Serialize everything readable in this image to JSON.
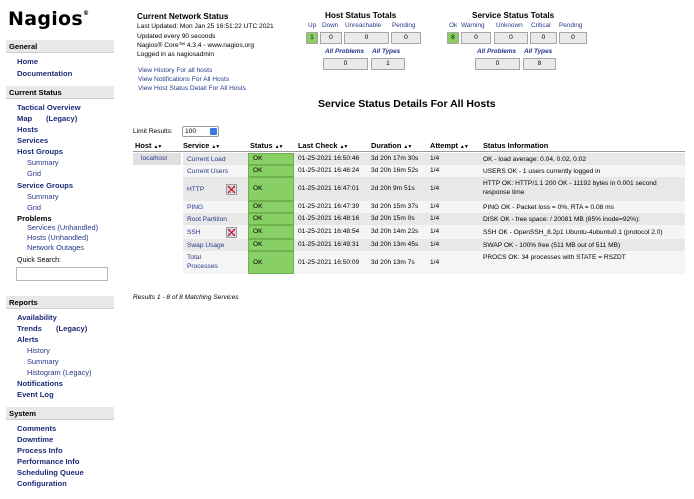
{
  "brand": {
    "name": "Nagios",
    "mark": "®"
  },
  "sidebar": {
    "general": {
      "title": "General",
      "items": [
        "Home",
        "Documentation"
      ]
    },
    "current_status": {
      "title": "Current Status",
      "tactical": "Tactical Overview",
      "map": "Map",
      "map_legacy": "(Legacy)",
      "hosts": "Hosts",
      "services": "Services",
      "host_groups": "Host Groups",
      "host_groups_sub": [
        "Summary",
        "Grid"
      ],
      "service_groups": "Service Groups",
      "service_groups_sub": [
        "Summary",
        "Grid"
      ],
      "problems": "Problems",
      "problems_sub": [
        "Services (Unhandled)",
        "Hosts (Unhandled)",
        "Network Outages"
      ],
      "quick_search": "Quick Search:"
    },
    "reports": {
      "title": "Reports",
      "availability": "Availability",
      "trends": "Trends",
      "trends_legacy": "(Legacy)",
      "alerts": "Alerts",
      "alerts_sub": [
        "History",
        "Summary",
        "Histogram (Legacy)"
      ],
      "notifications": "Notifications",
      "event_log": "Event Log"
    },
    "system": {
      "title": "System",
      "items": [
        "Comments",
        "Downtime",
        "Process Info",
        "Performance Info",
        "Scheduling Queue",
        "Configuration"
      ]
    }
  },
  "network_status": {
    "title": "Current Network Status",
    "last_updated": "Last Updated: Mon Jan 25 16:51:22 UTC 2021",
    "update_freq": "Updated every 90 seconds",
    "version": "Nagios® Core™ 4.3.4 - www.nagios.org",
    "logged_in": "Logged in as nagiosadmin",
    "links": [
      "View History For all hosts",
      "View Notifications For All Hosts",
      "View Host Status Detail For All Hosts"
    ]
  },
  "host_totals": {
    "title": "Host Status Totals",
    "labels": [
      "Up",
      "Down",
      "Unreachable",
      "Pending"
    ],
    "values": [
      "1",
      "0",
      "0",
      "0"
    ],
    "sub_labels": [
      "All Problems",
      "All Types"
    ],
    "sub_values": [
      "0",
      "1"
    ]
  },
  "service_totals": {
    "title": "Service Status Totals",
    "labels": [
      "Ok",
      "Warning",
      "Unknown",
      "Critical",
      "Pending"
    ],
    "values": [
      "8",
      "0",
      "0",
      "0",
      "0"
    ],
    "sub_labels": [
      "All Problems",
      "All Types"
    ],
    "sub_values": [
      "0",
      "8"
    ]
  },
  "main": {
    "title": "Service Status Details For All Hosts",
    "limit_label": "Limit Results:",
    "limit_value": "100",
    "columns": [
      "Host",
      "Service",
      "Status",
      "Last Check",
      "Duration",
      "Attempt",
      "Status Information"
    ],
    "host": "localhost",
    "rows": [
      {
        "service": "Current Load",
        "status": "OK",
        "last_check": "01-25-2021 16:50:46",
        "duration": "3d 20h 17m 30s",
        "attempt": "1/4",
        "info": "OK - load average: 0.04, 0.02, 0.02"
      },
      {
        "service": "Current Users",
        "status": "OK",
        "last_check": "01-25-2021 16:46:24",
        "duration": "3d 20h 16m 52s",
        "attempt": "1/4",
        "info": "USERS OK - 1 users currently logged in"
      },
      {
        "service": "HTTP",
        "status": "OK",
        "last_check": "01-25-2021 16:47:01",
        "duration": "2d 20h 9m 51s",
        "attempt": "1/4",
        "info": "HTTP OK: HTTP/1.1 200 OK - 11192 bytes in 0.001 second response time"
      },
      {
        "service": "PING",
        "status": "OK",
        "last_check": "01-25-2021 16:47:39",
        "duration": "3d 20h 15m 37s",
        "attempt": "1/4",
        "info": "PING OK - Packet loss = 0%, RTA = 0.08 ms"
      },
      {
        "service": "Root Partition",
        "status": "OK",
        "last_check": "01-25-2021 16:48:16",
        "duration": "3d 20h 15m 0s",
        "attempt": "1/4",
        "info": "DISK OK - free space: / 20081 MB (85% inode=92%):"
      },
      {
        "service": "SSH",
        "status": "OK",
        "last_check": "01-25-2021 16:48:54",
        "duration": "3d 20h 14m 22s",
        "attempt": "1/4",
        "info": "SSH OK - OpenSSH_8.2p1 Ubuntu-4ubuntu0.1 (protocol 2.0)"
      },
      {
        "service": "Swap Usage",
        "status": "OK",
        "last_check": "01-25-2021 16:49:31",
        "duration": "3d 20h 13m 45s",
        "attempt": "1/4",
        "info": "SWAP OK - 100% free (511 MB out of 511 MB)"
      },
      {
        "service": "Total Processes",
        "status": "OK",
        "last_check": "01-25-2021 16:50:09",
        "duration": "3d 20h 13m 7s",
        "attempt": "1/4",
        "info": "PROCS OK: 34 processes with STATE = RSZDT"
      }
    ],
    "results": "Results 1 - 8 of 8 Matching Services"
  },
  "icons": {
    "notifications_disabled": "notifications-disabled-icon"
  },
  "colors": {
    "ok": "#88d066",
    "link": "#26388a",
    "header_bg": "#e8e8e8"
  }
}
